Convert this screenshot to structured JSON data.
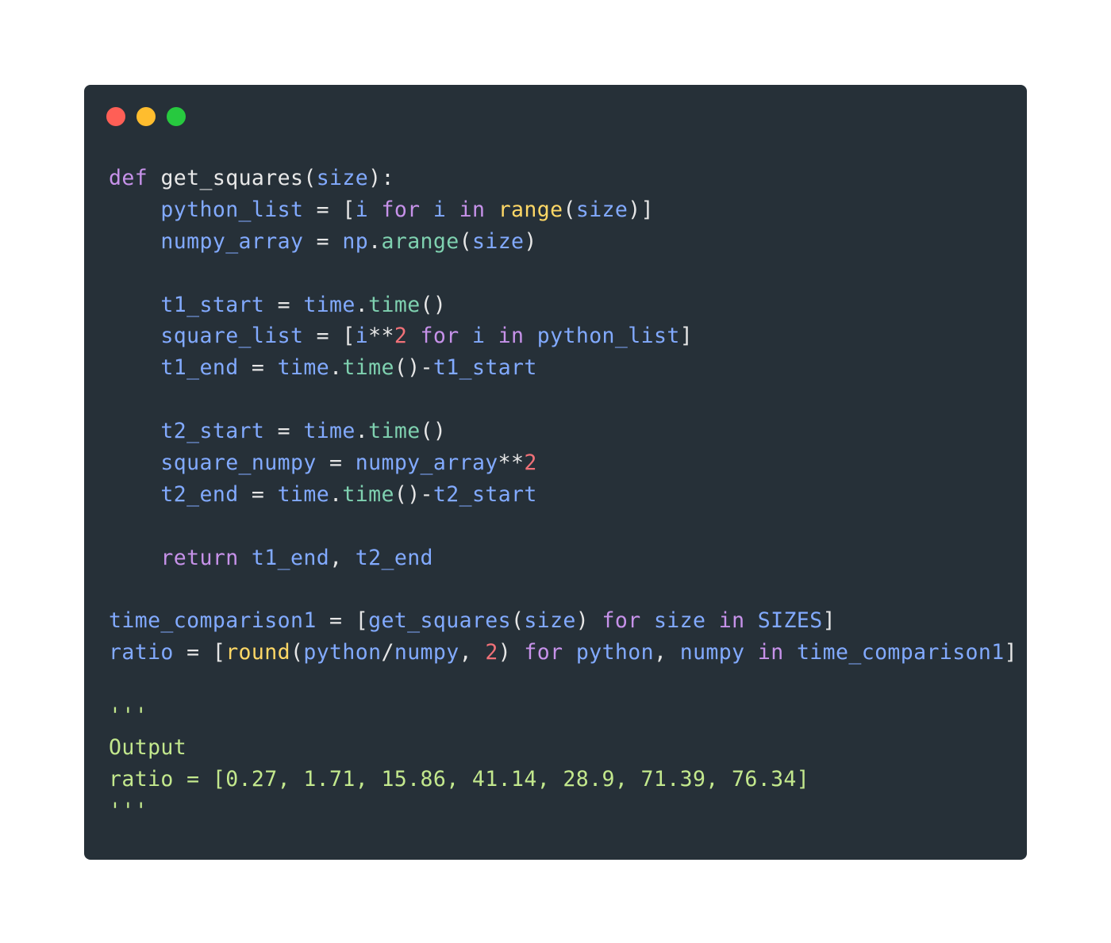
{
  "window": {
    "controls": [
      {
        "name": "close",
        "color": "#ff5f56"
      },
      {
        "name": "minimize",
        "color": "#ffbd2e"
      },
      {
        "name": "maximize",
        "color": "#27c93f"
      }
    ]
  },
  "code": {
    "language": "python",
    "lines": [
      [
        [
          "kw",
          "def"
        ],
        [
          "p",
          " "
        ],
        [
          "fn",
          "get_squares"
        ],
        [
          "p",
          "("
        ],
        [
          "v",
          "size"
        ],
        [
          "p",
          "):"
        ]
      ],
      [
        [
          "p",
          "    "
        ],
        [
          "v",
          "python_list"
        ],
        [
          "p",
          " = ["
        ],
        [
          "v",
          "i"
        ],
        [
          "p",
          " "
        ],
        [
          "kw",
          "for"
        ],
        [
          "p",
          " "
        ],
        [
          "v",
          "i"
        ],
        [
          "p",
          " "
        ],
        [
          "kw",
          "in"
        ],
        [
          "p",
          " "
        ],
        [
          "b",
          "range"
        ],
        [
          "p",
          "("
        ],
        [
          "v",
          "size"
        ],
        [
          "p",
          ")]"
        ]
      ],
      [
        [
          "p",
          "    "
        ],
        [
          "v",
          "numpy_array"
        ],
        [
          "p",
          " = "
        ],
        [
          "v",
          "np"
        ],
        [
          "p",
          "."
        ],
        [
          "m",
          "arange"
        ],
        [
          "p",
          "("
        ],
        [
          "v",
          "size"
        ],
        [
          "p",
          ")"
        ]
      ],
      [],
      [
        [
          "p",
          "    "
        ],
        [
          "v",
          "t1_start"
        ],
        [
          "p",
          " = "
        ],
        [
          "v",
          "time"
        ],
        [
          "p",
          "."
        ],
        [
          "m",
          "time"
        ],
        [
          "p",
          "()"
        ]
      ],
      [
        [
          "p",
          "    "
        ],
        [
          "v",
          "square_list"
        ],
        [
          "p",
          " = ["
        ],
        [
          "v",
          "i"
        ],
        [
          "p",
          "**"
        ],
        [
          "n",
          "2"
        ],
        [
          "p",
          " "
        ],
        [
          "kw",
          "for"
        ],
        [
          "p",
          " "
        ],
        [
          "v",
          "i"
        ],
        [
          "p",
          " "
        ],
        [
          "kw",
          "in"
        ],
        [
          "p",
          " "
        ],
        [
          "v",
          "python_list"
        ],
        [
          "p",
          "]"
        ]
      ],
      [
        [
          "p",
          "    "
        ],
        [
          "v",
          "t1_end"
        ],
        [
          "p",
          " = "
        ],
        [
          "v",
          "time"
        ],
        [
          "p",
          "."
        ],
        [
          "m",
          "time"
        ],
        [
          "p",
          "()-"
        ],
        [
          "v",
          "t1_start"
        ]
      ],
      [],
      [
        [
          "p",
          "    "
        ],
        [
          "v",
          "t2_start"
        ],
        [
          "p",
          " = "
        ],
        [
          "v",
          "time"
        ],
        [
          "p",
          "."
        ],
        [
          "m",
          "time"
        ],
        [
          "p",
          "()"
        ]
      ],
      [
        [
          "p",
          "    "
        ],
        [
          "v",
          "square_numpy"
        ],
        [
          "p",
          " = "
        ],
        [
          "v",
          "numpy_array"
        ],
        [
          "p",
          "**"
        ],
        [
          "n",
          "2"
        ]
      ],
      [
        [
          "p",
          "    "
        ],
        [
          "v",
          "t2_end"
        ],
        [
          "p",
          " = "
        ],
        [
          "v",
          "time"
        ],
        [
          "p",
          "."
        ],
        [
          "m",
          "time"
        ],
        [
          "p",
          "()-"
        ],
        [
          "v",
          "t2_start"
        ]
      ],
      [],
      [
        [
          "p",
          "    "
        ],
        [
          "kw",
          "return"
        ],
        [
          "p",
          " "
        ],
        [
          "v",
          "t1_end"
        ],
        [
          "p",
          ", "
        ],
        [
          "v",
          "t2_end"
        ]
      ],
      [],
      [
        [
          "v",
          "time_comparison1"
        ],
        [
          "p",
          " = ["
        ],
        [
          "v",
          "get_squares"
        ],
        [
          "p",
          "("
        ],
        [
          "v",
          "size"
        ],
        [
          "p",
          ") "
        ],
        [
          "kw",
          "for"
        ],
        [
          "p",
          " "
        ],
        [
          "v",
          "size"
        ],
        [
          "p",
          " "
        ],
        [
          "kw",
          "in"
        ],
        [
          "p",
          " "
        ],
        [
          "v",
          "SIZES"
        ],
        [
          "p",
          "]"
        ]
      ],
      [
        [
          "v",
          "ratio"
        ],
        [
          "p",
          " = ["
        ],
        [
          "b",
          "round"
        ],
        [
          "p",
          "("
        ],
        [
          "v",
          "python"
        ],
        [
          "p",
          "/"
        ],
        [
          "v",
          "numpy"
        ],
        [
          "p",
          ", "
        ],
        [
          "n",
          "2"
        ],
        [
          "p",
          ") "
        ],
        [
          "kw",
          "for"
        ],
        [
          "p",
          " "
        ],
        [
          "v",
          "python"
        ],
        [
          "p",
          ", "
        ],
        [
          "v",
          "numpy"
        ],
        [
          "p",
          " "
        ],
        [
          "kw",
          "in"
        ],
        [
          "p",
          " "
        ],
        [
          "v",
          "time_comparison1"
        ],
        [
          "p",
          "]"
        ]
      ],
      [],
      [
        [
          "s",
          "'''"
        ]
      ],
      [
        [
          "s",
          "Output"
        ]
      ],
      [
        [
          "s",
          "ratio = [0.27, 1.71, 15.86, 41.14, 28.9, 71.39, 76.34]"
        ]
      ],
      [
        [
          "s",
          "'''"
        ]
      ]
    ]
  }
}
